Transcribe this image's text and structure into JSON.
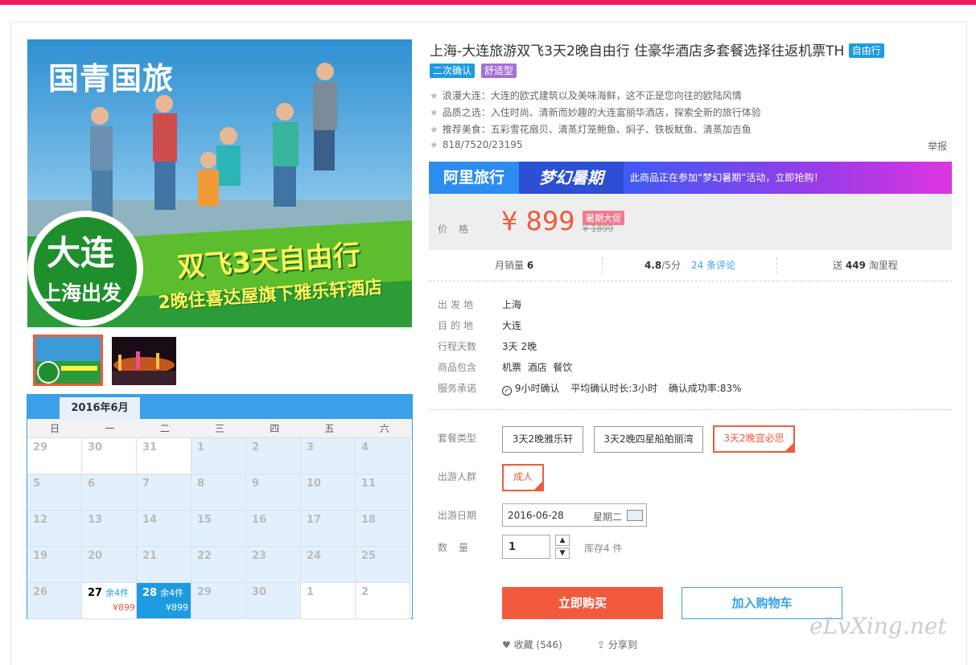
{
  "brand_logo": "国青国旅",
  "hero": {
    "city": "大连",
    "from": "上海出发",
    "headline": "双飞3天自由行",
    "subline": "2晚住喜达屋旗下雅乐轩酒店"
  },
  "calendar": {
    "month": "2016年6月",
    "weekdays": [
      "日",
      "一",
      "二",
      "三",
      "四",
      "五",
      "六"
    ],
    "weeks": [
      [
        "29",
        "30",
        "31",
        "1",
        "2",
        "3",
        "4"
      ],
      [
        "5",
        "6",
        "7",
        "8",
        "9",
        "10",
        "11"
      ],
      [
        "12",
        "13",
        "14",
        "15",
        "16",
        "17",
        "18"
      ],
      [
        "19",
        "20",
        "21",
        "22",
        "23",
        "24",
        "25"
      ],
      [
        "26",
        "27",
        "28",
        "29",
        "30",
        "1",
        "2"
      ]
    ],
    "day27": {
      "stock": "余4件",
      "price": "¥899"
    },
    "day28": {
      "stock": "余4件",
      "price": "¥899"
    }
  },
  "product": {
    "title": "上海-大连旅游双飞3天2晚自由行 住豪华酒店多套餐选择往返机票TH",
    "tag_free": "自由行",
    "tag_confirm": "二次确认",
    "tag_comfort": "舒适型",
    "features": [
      "浪漫大连：大连的欧式建筑以及美味海鲜，这不正是您向往的欧陆风情",
      "品质之选：入住时尚、清新而妙趣的大连富丽华酒店，探索全新的旅行体验",
      "推荐美食：五彩雪花扇贝、清蒸灯笼鲍鱼、焖子、铁板鱿鱼、清蒸加吉鱼",
      "818/7520/23195"
    ],
    "report": "举报"
  },
  "promo": {
    "platform": "阿里旅行",
    "campaign": "梦幻暑期",
    "text": "此商品正在参加“梦幻暑期”活动，立即抢购！"
  },
  "price": {
    "label": "价格",
    "value": "¥ 899",
    "badge": "暑期大促",
    "original": "¥ 1899"
  },
  "stats": {
    "sales_label": "月销量",
    "sales": "6",
    "rating": "4.8",
    "rating_suffix": "/5分",
    "reviews": "24 条评论",
    "miles_prefix": "送",
    "miles": "449",
    "miles_suffix": "淘里程"
  },
  "info": {
    "depart_label": "出发地",
    "depart": "上海",
    "dest_label": "目的地",
    "dest": "大连",
    "days_label": "行程天数",
    "days": "3天 2晚",
    "includes_label": "商品包含",
    "includes": "机票  酒店  餐饮",
    "service_label": "服务承诺",
    "service_confirm": "9小时确认",
    "service_avg": "平均确认时长:3小时",
    "service_rate": "确认成功率:83%"
  },
  "options": {
    "package_label": "套餐类型",
    "packages": [
      "3天2晚雅乐轩",
      "3天2晚四星船舶丽湾",
      "3天2晚宜必思"
    ],
    "people_label": "出游人群",
    "people": "成人",
    "date_label": "出游日期",
    "date": "2016-06-28",
    "weekday": "星期二",
    "qty_label": "数量",
    "qty": "1",
    "stock": "库存4 件"
  },
  "actions": {
    "buy": "立即购买",
    "cart": "加入购物车",
    "fav": "收藏 (546)",
    "share": "分享到"
  },
  "watermark": "eLvXing.net",
  "colors": {
    "accent": "#f05a3c",
    "blue": "#3aa0e8",
    "top": "#ef1c5a"
  }
}
